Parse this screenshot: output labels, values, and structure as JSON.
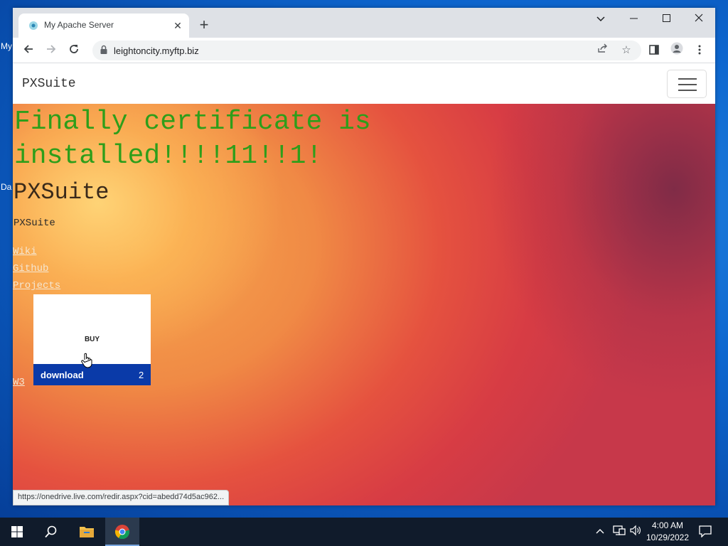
{
  "desktop": {
    "icon_labels": [
      "My",
      "Da"
    ]
  },
  "browser": {
    "tab_title": "My Apache Server",
    "url": "leightoncity.myftp.biz",
    "status_url": "https://onedrive.live.com/redir.aspx?cid=abedd74d5ac962...",
    "icons": [
      "globe-favicon",
      "close-icon",
      "plus-icon",
      "chevron-down-icon",
      "minimize-icon",
      "maximize-icon",
      "close-icon",
      "back-icon",
      "forward-icon",
      "reload-icon",
      "lock-icon",
      "share-icon",
      "star-icon",
      "side-panel-icon",
      "profile-icon",
      "menu-dots-icon"
    ]
  },
  "page": {
    "brand": "PXSuite",
    "headline": "Finally certificate is installed!!!!11!!1!",
    "heading": "PXSuite",
    "subtext": "PXSuite",
    "links": [
      "Wiki",
      "Github",
      "Projects",
      "W3"
    ],
    "card": {
      "button_label": "BUY",
      "bar_label": "download",
      "bar_count": "2"
    }
  },
  "taskbar": {
    "time": "4:00 AM",
    "date": "10/29/2022",
    "icons": [
      "windows-start-icon",
      "search-icon",
      "file-explorer-icon",
      "chrome-icon",
      "chevron-up-icon",
      "network-icon",
      "volume-icon",
      "notification-icon"
    ]
  }
}
